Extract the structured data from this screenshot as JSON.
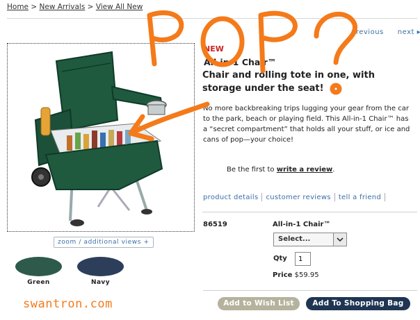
{
  "breadcrumb": {
    "home": "Home",
    "sep1": " > ",
    "new_arrivals": "New Arrivals",
    "sep2": " > ",
    "view_all": "View All New"
  },
  "pagination": {
    "previous": "previous",
    "next": "next ▸"
  },
  "product": {
    "badge": "NEW",
    "title": "All-in-1 Chair™",
    "tagline": "Chair and rolling tote in one, with storage under the seat!",
    "description": "No more backbreaking trips lugging your gear from the car to the park, beach or playing field. This All-in-1 Chair™ has a “secret compartment” that holds all your stuff, or ice and cans of pop—your choice!",
    "review_prefix": "Be the first to ",
    "review_link": "write a review",
    "review_suffix": ".",
    "zoom_link": "zoom / additional views +"
  },
  "tabs": [
    {
      "label": "product details"
    },
    {
      "label": "customer reviews"
    },
    {
      "label": "tell a friend"
    }
  ],
  "swatches": [
    {
      "label": "Green",
      "color": "#2e5a4c"
    },
    {
      "label": "Navy",
      "color": "#2c3e5a"
    }
  ],
  "order": {
    "sku": "86519",
    "item_name": "All-in-1 Chair™",
    "select_value": "Select...",
    "qty_label": "Qty",
    "qty_value": "1",
    "price_label": "Price",
    "price_value": "$59.95"
  },
  "buttons": {
    "wishlist": "Add to Wish List",
    "cart": "Add To Shopping Bag"
  },
  "annotation": {
    "scribble_text": "POP?",
    "watermark": "swantron.com",
    "color": "#f47a1a"
  }
}
